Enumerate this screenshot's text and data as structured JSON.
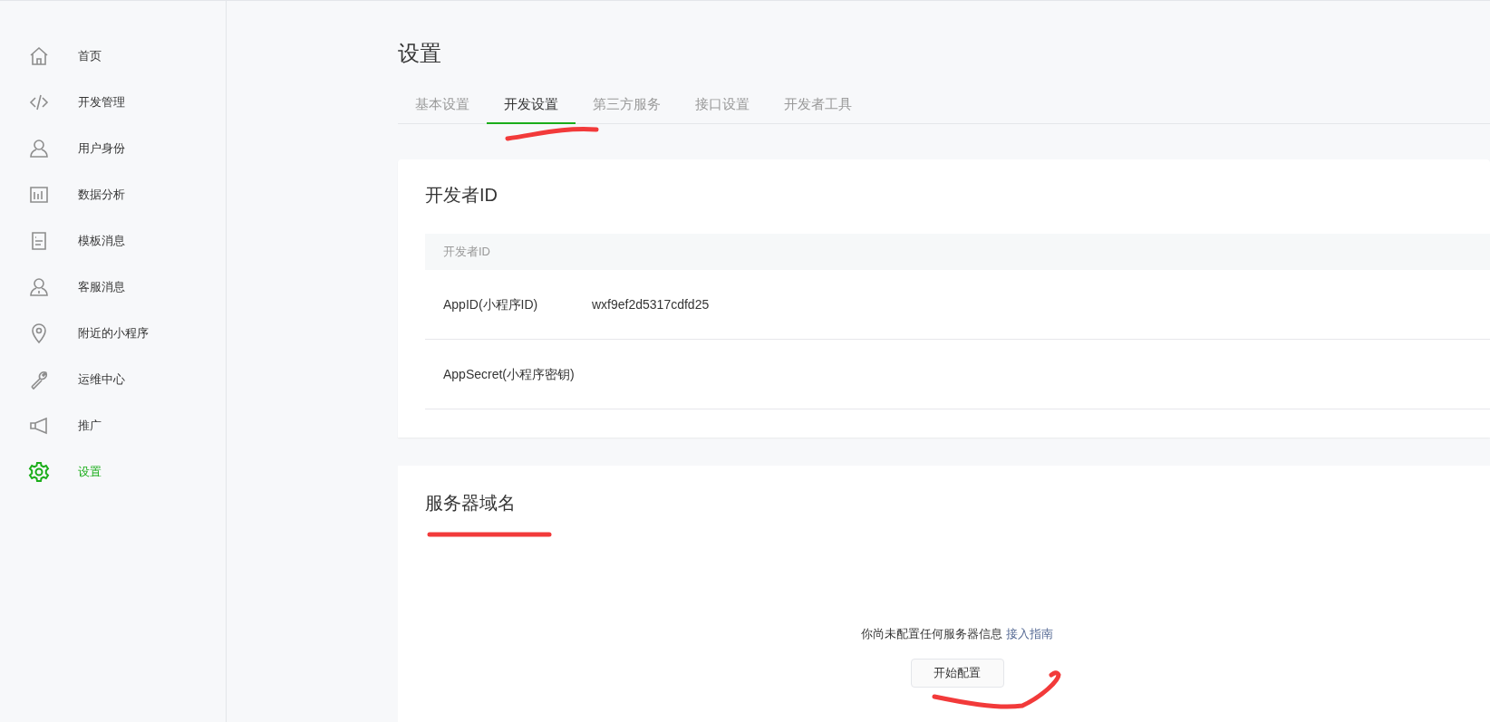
{
  "sidebar": {
    "items": [
      {
        "label": "首页",
        "selected": false
      },
      {
        "label": "开发管理",
        "selected": false
      },
      {
        "label": "用户身份",
        "selected": false
      },
      {
        "label": "数据分析",
        "selected": false
      },
      {
        "label": "模板消息",
        "selected": false
      },
      {
        "label": "客服消息",
        "selected": false
      },
      {
        "label": "附近的小程序",
        "selected": false
      },
      {
        "label": "运维中心",
        "selected": false
      },
      {
        "label": "推广",
        "selected": false
      },
      {
        "label": "设置",
        "selected": true
      }
    ]
  },
  "page_title": "设置",
  "tabs": [
    {
      "label": "基本设置",
      "selected": false
    },
    {
      "label": "开发设置",
      "selected": true
    },
    {
      "label": "第三方服务",
      "selected": false
    },
    {
      "label": "接口设置",
      "selected": false
    },
    {
      "label": "开发者工具",
      "selected": false
    }
  ],
  "developer_id": {
    "title": "开发者ID",
    "table": {
      "columns": [
        "开发者ID"
      ],
      "rows": [
        [
          "AppID(小程序ID)",
          "wxf9ef2d5317cdfd25"
        ],
        [
          "AppSecret(小程序密钥)"
        ]
      ]
    }
  },
  "server_domain": {
    "title": "服务器域名",
    "message": "你尚未配置任何服务器信息",
    "link": "接入指南",
    "button": "开始配置"
  }
}
